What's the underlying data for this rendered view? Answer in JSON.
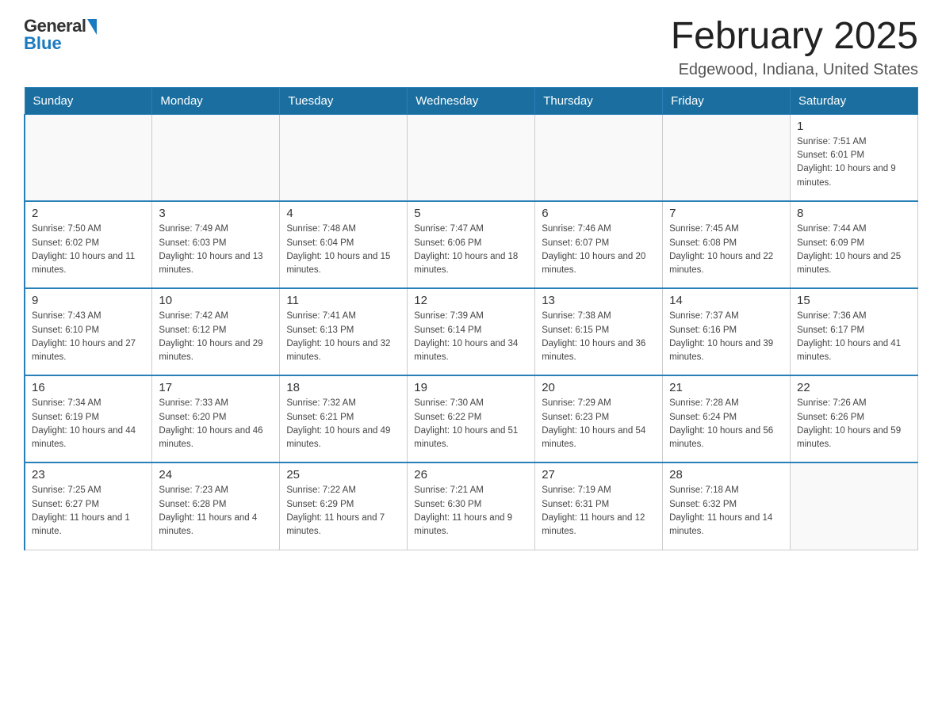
{
  "logo": {
    "general": "General",
    "blue": "Blue"
  },
  "header": {
    "title": "February 2025",
    "location": "Edgewood, Indiana, United States"
  },
  "weekdays": [
    "Sunday",
    "Monday",
    "Tuesday",
    "Wednesday",
    "Thursday",
    "Friday",
    "Saturday"
  ],
  "weeks": [
    [
      {
        "day": "",
        "info": ""
      },
      {
        "day": "",
        "info": ""
      },
      {
        "day": "",
        "info": ""
      },
      {
        "day": "",
        "info": ""
      },
      {
        "day": "",
        "info": ""
      },
      {
        "day": "",
        "info": ""
      },
      {
        "day": "1",
        "info": "Sunrise: 7:51 AM\nSunset: 6:01 PM\nDaylight: 10 hours and 9 minutes."
      }
    ],
    [
      {
        "day": "2",
        "info": "Sunrise: 7:50 AM\nSunset: 6:02 PM\nDaylight: 10 hours and 11 minutes."
      },
      {
        "day": "3",
        "info": "Sunrise: 7:49 AM\nSunset: 6:03 PM\nDaylight: 10 hours and 13 minutes."
      },
      {
        "day": "4",
        "info": "Sunrise: 7:48 AM\nSunset: 6:04 PM\nDaylight: 10 hours and 15 minutes."
      },
      {
        "day": "5",
        "info": "Sunrise: 7:47 AM\nSunset: 6:06 PM\nDaylight: 10 hours and 18 minutes."
      },
      {
        "day": "6",
        "info": "Sunrise: 7:46 AM\nSunset: 6:07 PM\nDaylight: 10 hours and 20 minutes."
      },
      {
        "day": "7",
        "info": "Sunrise: 7:45 AM\nSunset: 6:08 PM\nDaylight: 10 hours and 22 minutes."
      },
      {
        "day": "8",
        "info": "Sunrise: 7:44 AM\nSunset: 6:09 PM\nDaylight: 10 hours and 25 minutes."
      }
    ],
    [
      {
        "day": "9",
        "info": "Sunrise: 7:43 AM\nSunset: 6:10 PM\nDaylight: 10 hours and 27 minutes."
      },
      {
        "day": "10",
        "info": "Sunrise: 7:42 AM\nSunset: 6:12 PM\nDaylight: 10 hours and 29 minutes."
      },
      {
        "day": "11",
        "info": "Sunrise: 7:41 AM\nSunset: 6:13 PM\nDaylight: 10 hours and 32 minutes."
      },
      {
        "day": "12",
        "info": "Sunrise: 7:39 AM\nSunset: 6:14 PM\nDaylight: 10 hours and 34 minutes."
      },
      {
        "day": "13",
        "info": "Sunrise: 7:38 AM\nSunset: 6:15 PM\nDaylight: 10 hours and 36 minutes."
      },
      {
        "day": "14",
        "info": "Sunrise: 7:37 AM\nSunset: 6:16 PM\nDaylight: 10 hours and 39 minutes."
      },
      {
        "day": "15",
        "info": "Sunrise: 7:36 AM\nSunset: 6:17 PM\nDaylight: 10 hours and 41 minutes."
      }
    ],
    [
      {
        "day": "16",
        "info": "Sunrise: 7:34 AM\nSunset: 6:19 PM\nDaylight: 10 hours and 44 minutes."
      },
      {
        "day": "17",
        "info": "Sunrise: 7:33 AM\nSunset: 6:20 PM\nDaylight: 10 hours and 46 minutes."
      },
      {
        "day": "18",
        "info": "Sunrise: 7:32 AM\nSunset: 6:21 PM\nDaylight: 10 hours and 49 minutes."
      },
      {
        "day": "19",
        "info": "Sunrise: 7:30 AM\nSunset: 6:22 PM\nDaylight: 10 hours and 51 minutes."
      },
      {
        "day": "20",
        "info": "Sunrise: 7:29 AM\nSunset: 6:23 PM\nDaylight: 10 hours and 54 minutes."
      },
      {
        "day": "21",
        "info": "Sunrise: 7:28 AM\nSunset: 6:24 PM\nDaylight: 10 hours and 56 minutes."
      },
      {
        "day": "22",
        "info": "Sunrise: 7:26 AM\nSunset: 6:26 PM\nDaylight: 10 hours and 59 minutes."
      }
    ],
    [
      {
        "day": "23",
        "info": "Sunrise: 7:25 AM\nSunset: 6:27 PM\nDaylight: 11 hours and 1 minute."
      },
      {
        "day": "24",
        "info": "Sunrise: 7:23 AM\nSunset: 6:28 PM\nDaylight: 11 hours and 4 minutes."
      },
      {
        "day": "25",
        "info": "Sunrise: 7:22 AM\nSunset: 6:29 PM\nDaylight: 11 hours and 7 minutes."
      },
      {
        "day": "26",
        "info": "Sunrise: 7:21 AM\nSunset: 6:30 PM\nDaylight: 11 hours and 9 minutes."
      },
      {
        "day": "27",
        "info": "Sunrise: 7:19 AM\nSunset: 6:31 PM\nDaylight: 11 hours and 12 minutes."
      },
      {
        "day": "28",
        "info": "Sunrise: 7:18 AM\nSunset: 6:32 PM\nDaylight: 11 hours and 14 minutes."
      },
      {
        "day": "",
        "info": ""
      }
    ]
  ]
}
